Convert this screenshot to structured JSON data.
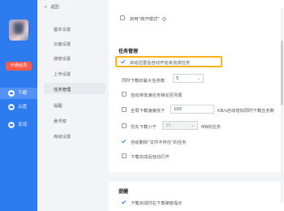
{
  "app_sidebar": {
    "vip_label": "开通会员",
    "nav": [
      {
        "label": "下载",
        "icon": "download-icon"
      },
      {
        "label": "云盘",
        "icon": "cloud-icon"
      },
      {
        "label": "发现",
        "icon": "discover-icon"
      }
    ]
  },
  "settings_nav": {
    "back_label": "返回",
    "items": [
      "基本设置",
      "云盘设置",
      "接管设置",
      "上传设置",
      "任务管理",
      "提醒",
      "悬浮窗",
      "高级设置"
    ]
  },
  "content": {
    "top_row": "启用\"高开模式\"",
    "task_section_title": "任务管理",
    "options": {
      "auto_start": "启动迅雷后自动开始未完成任务",
      "max_tasks_label": "同时下载的最大任务数",
      "max_tasks_value": "5",
      "auto_move": "自动将低速任务移动至列尾",
      "global_speed_prefix": "全局下载速度低于",
      "global_speed_value": "100",
      "global_speed_suffix": "KB/s自动增加同时下载任务数",
      "prefer_small_prefix": "优先下载小于",
      "prefer_small_value": "30",
      "prefer_small_suffix": "MB的任务",
      "auto_delete": "自动删除\"文件不存在\"的任务",
      "auto_open": "下载完成后自动打开"
    },
    "remind_section_title": "提醒",
    "remind_option": "下载完成时右下角弹窗提示"
  }
}
